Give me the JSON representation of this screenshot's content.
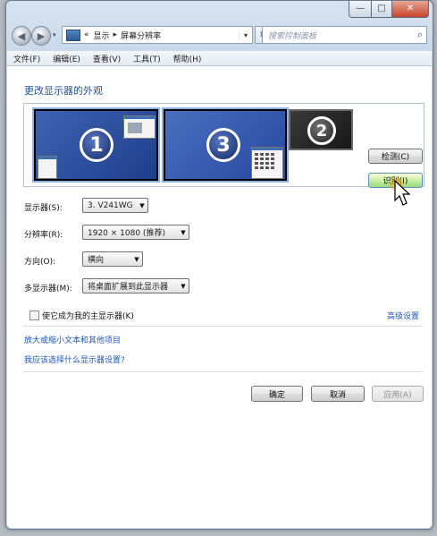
{
  "window": {
    "caption_minimize": "—",
    "caption_maximize": "□",
    "caption_close": "✕"
  },
  "navbar": {
    "history_arrow": "▾",
    "breadcrumb_prefix": "«",
    "breadcrumb_1": "显示",
    "breadcrumb_sep": "▸",
    "breadcrumb_2": "屏幕分辨率",
    "address_dropdown": "▾",
    "refresh": "↻",
    "search_placeholder": "搜索控制面板",
    "search_icon": "⌕"
  },
  "menubar": {
    "items": [
      "文件(F)",
      "编辑(E)",
      "查看(V)",
      "工具(T)",
      "帮助(H)"
    ]
  },
  "main": {
    "title": "更改显示器的外观",
    "monitors": [
      {
        "id": "1"
      },
      {
        "id": "3"
      },
      {
        "id": "2"
      }
    ],
    "detect_button": "检测(C)",
    "identify_button": "识别(I)",
    "display_label": "显示器(S):",
    "display_value": "3. V241WG",
    "resolution_label": "分辨率(R):",
    "resolution_value": "1920 × 1080 (推荐)",
    "orientation_label": "方向(O):",
    "orientation_value": "横向",
    "multi_label": "多显示器(M):",
    "multi_value": "将桌面扩展到此显示器",
    "primary_checkbox_label": "使它成为我的主显示器(K)",
    "advanced_link": "高级设置",
    "link_enlarge": "放大或缩小文本和其他项目",
    "link_which": "我应该选择什么显示器设置?",
    "ok_button": "确定",
    "cancel_button": "取消",
    "apply_button": "应用(A)"
  },
  "colors": {
    "link": "#1b58b8",
    "title": "#1f4f9a",
    "selected_monitor": "#2648a0"
  }
}
